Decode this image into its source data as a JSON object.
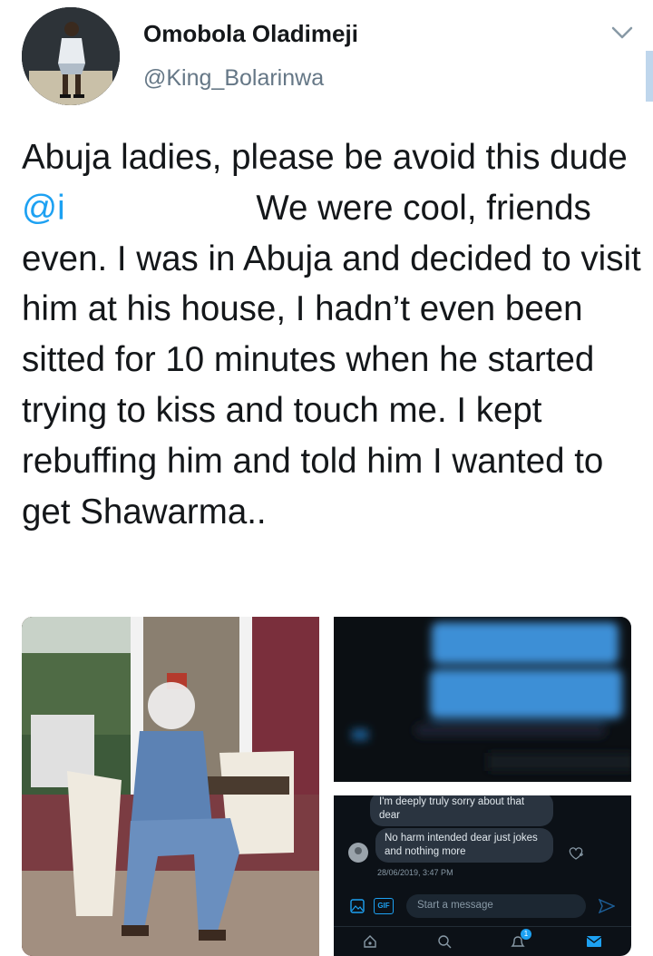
{
  "author": {
    "name": "Omobola Oladimeji",
    "handle": "@King_Bolarinwa"
  },
  "tweet": {
    "text_before_mention": "Abuja ladies, please be avoid this dude ",
    "mention": "@i",
    "text_after_mention": "  We were cool, friends even. I was in Abuja and decided to visit him at his house, I hadn’t even been sitted for 10 minutes when he started trying to kiss and touch me. I kept rebuffing him and told him I wanted to get Shawarma.."
  },
  "dm_screenshot": {
    "message_1": "I'm deeply truly sorry about that dear",
    "message_2": "No harm intended dear just jokes and nothing more",
    "timestamp": "28/06/2019, 3:47 PM",
    "composer_placeholder": "Start a message",
    "gif_label": "GIF",
    "notification_count": "1"
  },
  "colors": {
    "link": "#1da1f2",
    "secondary_text": "#657786",
    "dm_background": "#0c1117"
  },
  "icons": [
    "chevron-down-icon",
    "image-icon",
    "gif-icon",
    "send-icon",
    "home-icon",
    "search-icon",
    "bell-icon",
    "mail-icon",
    "reply-icon"
  ]
}
